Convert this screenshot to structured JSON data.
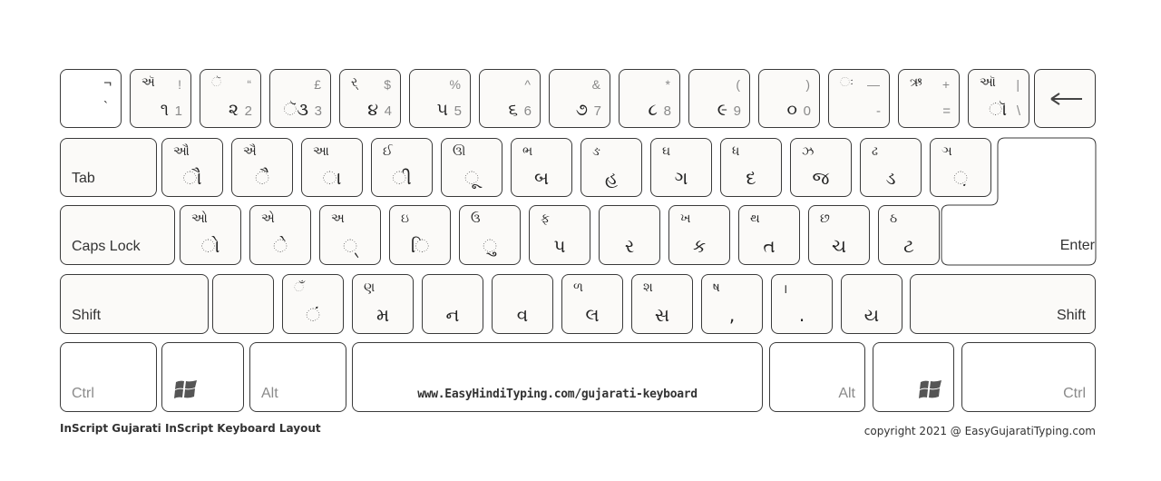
{
  "keyboard": {
    "row1": [
      {
        "top": "¬",
        "main": "`",
        "num": ""
      },
      {
        "top": "ઍ",
        "sym": "!",
        "main": "૧",
        "num": "1"
      },
      {
        "top": "ૅ",
        "sym": "“",
        "main": "૨",
        "num": "2"
      },
      {
        "top": "",
        "sym": "£",
        "main": "ૅ૩",
        "num": "3"
      },
      {
        "top": "ર્",
        "sym": "$",
        "main": "૪",
        "num": "4"
      },
      {
        "top": "",
        "sym": "%",
        "main": "૫",
        "num": "5"
      },
      {
        "top": "",
        "sym": "^",
        "main": "૬",
        "num": "6"
      },
      {
        "top": "",
        "sym": "&",
        "main": "૭",
        "num": "7"
      },
      {
        "top": "",
        "sym": "*",
        "main": "૮",
        "num": "8"
      },
      {
        "top": "",
        "sym": "(",
        "main": "૯",
        "num": "9"
      },
      {
        "top": "",
        "sym": ")",
        "main": "૦",
        "num": "0"
      },
      {
        "top": "ઃ",
        "sym": "—",
        "main": "",
        "num": "-"
      },
      {
        "top": "ઋ",
        "sym": "+",
        "main": "",
        "num": "="
      },
      {
        "top": "ઑ",
        "sym": "|",
        "main": "ૉ",
        "num": "\\"
      }
    ],
    "backspace": {
      "icon": "left-arrow-icon"
    },
    "tab_label": "Tab",
    "row2": [
      {
        "top": "ઔ",
        "main": "ૌ"
      },
      {
        "top": "ઐ",
        "main": "ૈ"
      },
      {
        "top": "આ",
        "main": "ા"
      },
      {
        "top": "ઈ",
        "main": "ી"
      },
      {
        "top": "ઊ",
        "main": "ૂ"
      },
      {
        "top": "ભ",
        "main": "બ"
      },
      {
        "top": "ઙ",
        "main": "હ"
      },
      {
        "top": "ઘ",
        "main": "ગ"
      },
      {
        "top": "ધ",
        "main": "દ"
      },
      {
        "top": "ઝ",
        "main": "જ"
      },
      {
        "top": "ઢ",
        "main": "ડ"
      },
      {
        "top": "ઞ",
        "main": "઼"
      }
    ],
    "caps_label": "Caps Lock",
    "row3": [
      {
        "top": "ઓ",
        "main": "ો"
      },
      {
        "top": "એ",
        "main": "ે"
      },
      {
        "top": "અ",
        "main": "્"
      },
      {
        "top": "ઇ",
        "main": "િ"
      },
      {
        "top": "ઉ",
        "main": "ુ"
      },
      {
        "top": "ફ",
        "main": "પ"
      },
      {
        "top": "",
        "main": "ર"
      },
      {
        "top": "ખ",
        "main": "ક"
      },
      {
        "top": "થ",
        "main": "ત"
      },
      {
        "top": "છ",
        "main": "ચ"
      },
      {
        "top": "ઠ",
        "main": "ટ"
      }
    ],
    "enter_label": "Enter",
    "shift_label": "Shift",
    "row4": [
      {
        "top": "",
        "main": ""
      },
      {
        "top": "ઁ",
        "main": "ં"
      },
      {
        "top": "ણ",
        "main": "મ"
      },
      {
        "top": "",
        "main": "ન"
      },
      {
        "top": "",
        "main": "વ"
      },
      {
        "top": "ળ",
        "main": "લ"
      },
      {
        "top": "શ",
        "main": "સ"
      },
      {
        "top": "ષ",
        "main": ","
      },
      {
        "top": "।",
        "main": "."
      },
      {
        "top": "",
        "main": "ય"
      }
    ],
    "right_shift_label": "Shift",
    "ctrl_label": "Ctrl",
    "alt_label": "Alt",
    "space_text": "www.EasyHindiTyping.com/gujarati-keyboard"
  },
  "footer": {
    "title": "InScript Gujarati InScript Keyboard Layout",
    "copyright": "copyright 2021 @ EasyGujaratiTyping.com"
  }
}
